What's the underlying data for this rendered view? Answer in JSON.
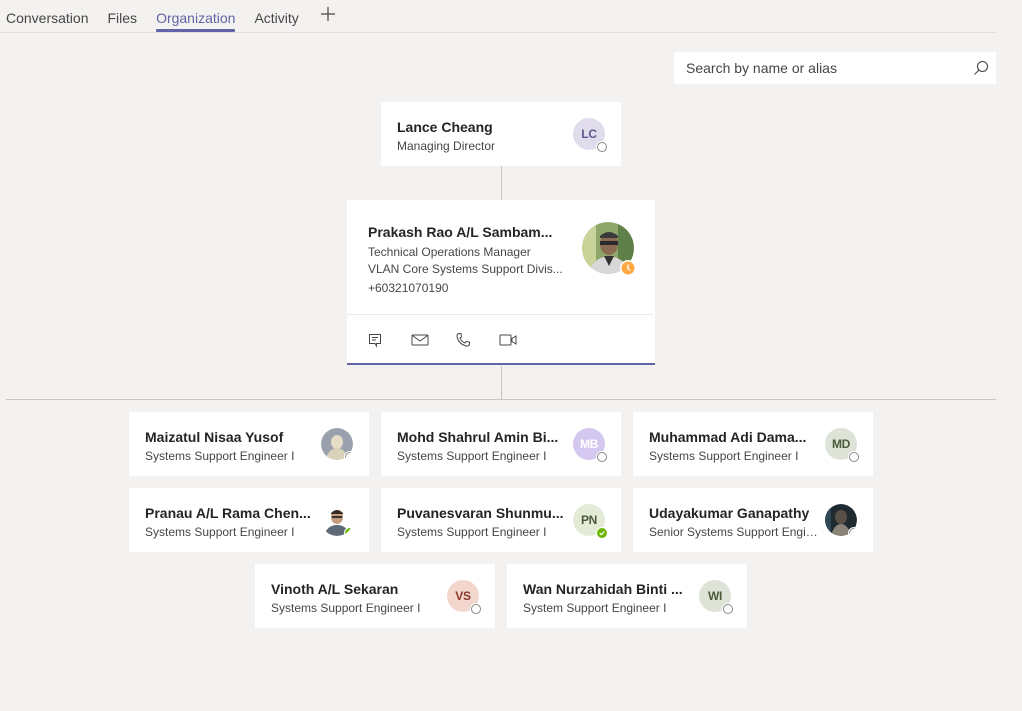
{
  "tabs": [
    {
      "label": "Conversation",
      "active": false
    },
    {
      "label": "Files",
      "active": false
    },
    {
      "label": "Organization",
      "active": true
    },
    {
      "label": "Activity",
      "active": false
    }
  ],
  "add_tab_icon": "plus-icon",
  "search": {
    "placeholder": "Search by name or alias",
    "value": "",
    "icon": "search-icon"
  },
  "colors": {
    "accent": "#6264a7",
    "available": "#6bb700",
    "away": "#ffaa44"
  },
  "manager": {
    "name": "Lance Cheang",
    "title": "Managing Director",
    "initials": "LC",
    "avatar_bg": "#e0dcec",
    "avatar_fg": "#5b5a8e",
    "presence": "offline"
  },
  "focus": {
    "name": "Prakash Rao A/L Sambam...",
    "title": "Technical Operations Manager",
    "department": "VLAN Core Systems Support Divis...",
    "phone": "+60321070190",
    "presence": "away",
    "avatar": "photo",
    "actions": [
      {
        "name": "chat",
        "icon": "chat-icon"
      },
      {
        "name": "email",
        "icon": "mail-icon"
      },
      {
        "name": "call",
        "icon": "phone-icon"
      },
      {
        "name": "video",
        "icon": "video-icon"
      }
    ]
  },
  "reports": [
    {
      "name": "Maizatul Nisaa Yusof",
      "title": "Systems Support Engineer I",
      "avatar": "photo",
      "presence": "offline"
    },
    {
      "name": "Mohd Shahrul Amin Bi...",
      "title": "Systems Support Engineer I",
      "initials": "MB",
      "avatar_bg": "#d4c8f0",
      "avatar_fg": "#ffffff",
      "presence": "offline"
    },
    {
      "name": "Muhammad Adi Dama...",
      "title": "Systems Support Engineer I",
      "initials": "MD",
      "avatar_bg": "#dde3d6",
      "avatar_fg": "#4a5a3a",
      "presence": "offline"
    },
    {
      "name": "Pranau A/L Rama Chen...",
      "title": "Systems Support Engineer I",
      "avatar": "photo",
      "presence": "available"
    },
    {
      "name": "Puvanesvaran Shunmu...",
      "title": "Systems Support Engineer I",
      "initials": "PN",
      "avatar_bg": "#e3ead6",
      "avatar_fg": "#4a5a3a",
      "presence": "available"
    },
    {
      "name": "Udayakumar Ganapathy",
      "title": "Senior Systems Support Engin...",
      "avatar": "photo",
      "presence": "offline"
    },
    {
      "name": "Vinoth A/L Sekaran",
      "title": "Systems Support Engineer I",
      "initials": "VS",
      "avatar_bg": "#f3d6cd",
      "avatar_fg": "#8a3a2a",
      "presence": "offline"
    },
    {
      "name": "Wan Nurzahidah Binti ...",
      "title": "System Support Engineer I",
      "initials": "WI",
      "avatar_bg": "#dde3d6",
      "avatar_fg": "#4a5a3a",
      "presence": "offline"
    }
  ]
}
